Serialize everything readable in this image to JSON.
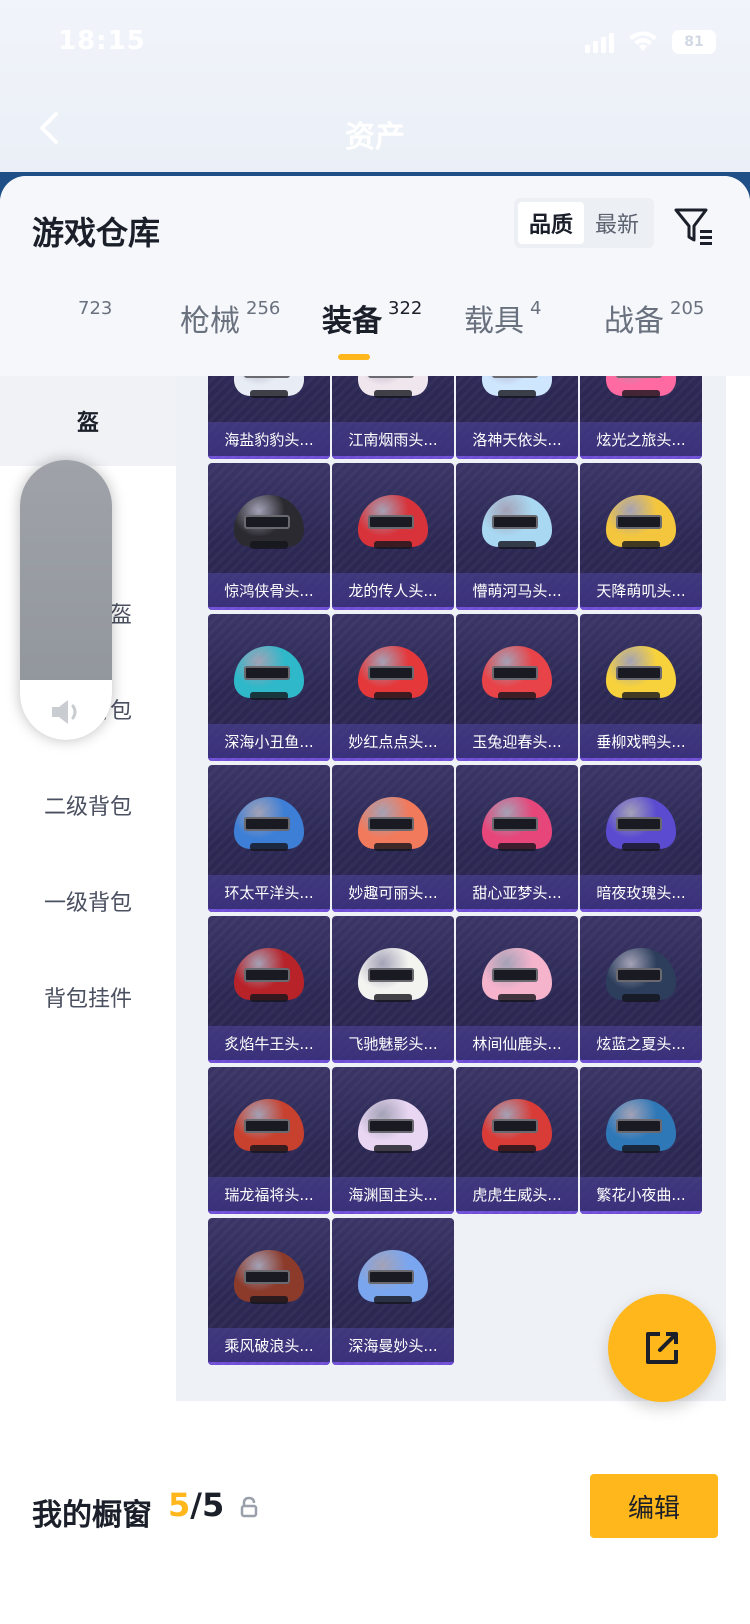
{
  "status_bar": {
    "time": "18:15",
    "battery": "81"
  },
  "nav": {
    "title": "资产"
  },
  "warehouse": {
    "title": "游戏仓库",
    "sort_options": [
      "品质",
      "最新"
    ],
    "active_sort": "品质"
  },
  "tabs": [
    {
      "label": "",
      "count": "723"
    },
    {
      "label": "枪械",
      "count": "256"
    },
    {
      "label": "装备",
      "count": "322"
    },
    {
      "label": "载具",
      "count": "4"
    },
    {
      "label": "战备",
      "count": "205"
    }
  ],
  "sidebar": {
    "items": [
      "盔",
      "盔",
      "一级头盔",
      "三级背包",
      "二级背包",
      "一级背包",
      "背包挂件"
    ],
    "active_index": 0
  },
  "grid": {
    "items": [
      {
        "name": "海盐豹豹头...",
        "color": "#e8edf5"
      },
      {
        "name": "江南烟雨头...",
        "color": "#f0e6ee"
      },
      {
        "name": "洛神天依头...",
        "color": "#cfe6ff"
      },
      {
        "name": "炫光之旅头...",
        "color": "#ff6aa2"
      },
      {
        "name": "惊鸿侠骨头...",
        "color": "#2b2a30"
      },
      {
        "name": "龙的传人头...",
        "color": "#d8333a"
      },
      {
        "name": "懵萌河马头...",
        "color": "#a9d8f2"
      },
      {
        "name": "天降萌叽头...",
        "color": "#f4c63e"
      },
      {
        "name": "深海小丑鱼...",
        "color": "#2fb8c9"
      },
      {
        "name": "妙红点点头...",
        "color": "#e4383b"
      },
      {
        "name": "玉兔迎春头...",
        "color": "#e84348"
      },
      {
        "name": "垂柳戏鸭头...",
        "color": "#f7d23c"
      },
      {
        "name": "环太平洋头...",
        "color": "#3d7fd6"
      },
      {
        "name": "妙趣可丽头...",
        "color": "#f27a5c"
      },
      {
        "name": "甜心亚梦头...",
        "color": "#e6467a"
      },
      {
        "name": "暗夜玫瑰头...",
        "color": "#5a4bd0"
      },
      {
        "name": "炙焰牛王头...",
        "color": "#b8232a"
      },
      {
        "name": "飞驰魅影头...",
        "color": "#f3f3f0"
      },
      {
        "name": "林间仙鹿头...",
        "color": "#f5b3cc"
      },
      {
        "name": "炫蓝之夏头...",
        "color": "#2c3e5c"
      },
      {
        "name": "瑞龙福将头...",
        "color": "#c8402e"
      },
      {
        "name": "海渊国主头...",
        "color": "#e8d6f2"
      },
      {
        "name": "虎虎生威头...",
        "color": "#d93b36"
      },
      {
        "name": "繁花小夜曲...",
        "color": "#2e78b8"
      },
      {
        "name": "乘风破浪头...",
        "color": "#8c3a2a"
      },
      {
        "name": "深海曼妙头...",
        "color": "#7aa6f0"
      }
    ]
  },
  "showcase": {
    "title": "我的橱窗",
    "current": "5",
    "total": "/5",
    "edit_label": "编辑"
  },
  "colors": {
    "accent": "#ffb71b",
    "card_bg": "#2c2854",
    "header_blue": "#1e4f86"
  },
  "icons": [
    "back-icon",
    "filter-icon",
    "speaker-icon",
    "share-icon",
    "lock-icon"
  ]
}
